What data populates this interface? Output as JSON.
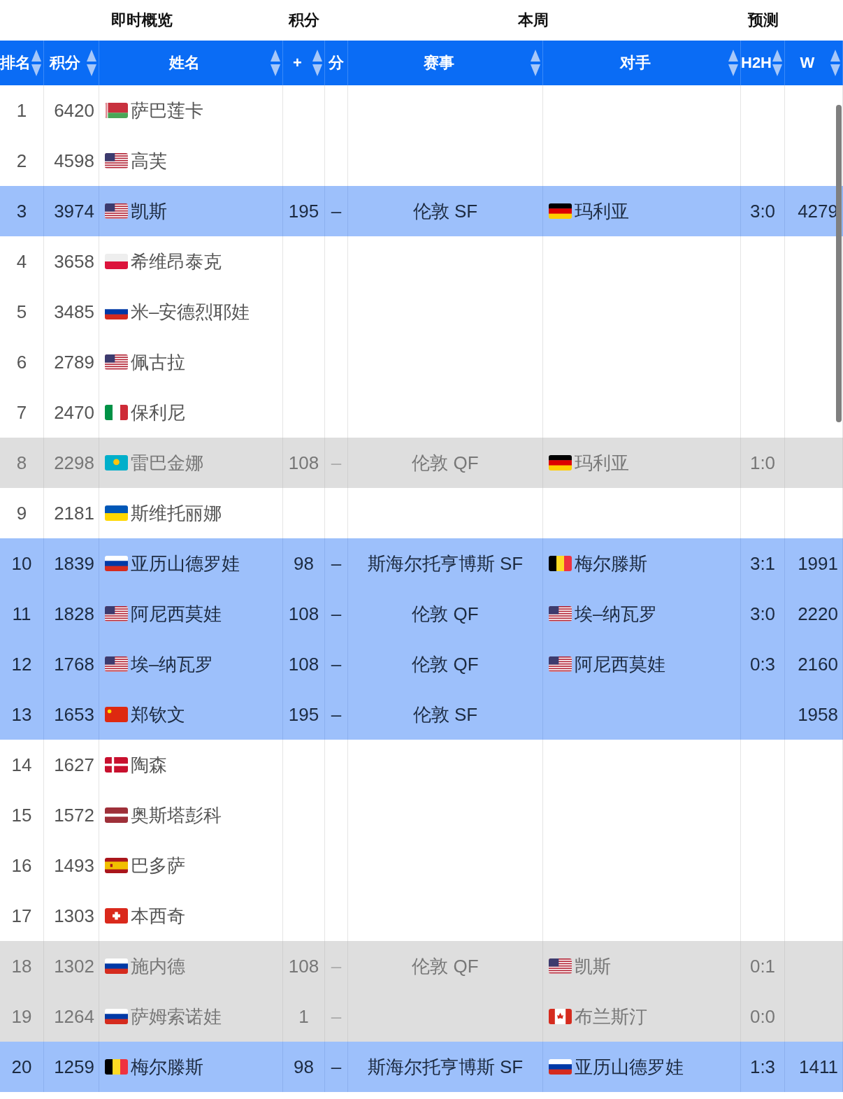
{
  "groups": [
    {
      "label": "即时概览"
    },
    {
      "label": "积分"
    },
    {
      "label": "本周"
    },
    {
      "label": "预测"
    }
  ],
  "columns": [
    {
      "label": "排名",
      "sortable": true
    },
    {
      "label": "积分",
      "sortable": true
    },
    {
      "label": "姓名",
      "sortable": true
    },
    {
      "label": "+",
      "sortable": true
    },
    {
      "label": "分",
      "sortable": false
    },
    {
      "label": "赛事",
      "sortable": true
    },
    {
      "label": "对手",
      "sortable": true
    },
    {
      "label": "H2H",
      "sortable": true
    },
    {
      "label": "W",
      "sortable": true
    }
  ],
  "rows": [
    {
      "rank": "1",
      "points": "6420",
      "flag": {
        "kind": "by"
      },
      "name": "萨巴莲卡",
      "playing": false,
      "out": false
    },
    {
      "rank": "2",
      "points": "4598",
      "flag": {
        "kind": "us"
      },
      "name": "高芙",
      "playing": false,
      "out": false
    },
    {
      "rank": "3",
      "points": "3974",
      "flag": {
        "kind": "us"
      },
      "name": "凯斯",
      "playing": true,
      "out": false,
      "plus": "195",
      "minus": "–",
      "event": "伦敦 SF",
      "opponent_flag": {
        "kind": "de"
      },
      "opponent": "玛利亚",
      "h2h": "3:0",
      "w": "4279"
    },
    {
      "rank": "4",
      "points": "3658",
      "flag": {
        "kind": "pl"
      },
      "name": "希维昂泰克",
      "playing": false,
      "out": false
    },
    {
      "rank": "5",
      "points": "3485",
      "flag": {
        "kind": "ru"
      },
      "name": "米–安德烈耶娃",
      "playing": false,
      "out": false
    },
    {
      "rank": "6",
      "points": "2789",
      "flag": {
        "kind": "us"
      },
      "name": "佩古拉",
      "playing": false,
      "out": false
    },
    {
      "rank": "7",
      "points": "2470",
      "flag": {
        "kind": "it"
      },
      "name": "保利尼",
      "playing": false,
      "out": false
    },
    {
      "rank": "8",
      "points": "2298",
      "flag": {
        "kind": "kz"
      },
      "name": "雷巴金娜",
      "playing": false,
      "out": true,
      "plus": "108",
      "minus": "–",
      "event": "伦敦 QF",
      "opponent_flag": {
        "kind": "de"
      },
      "opponent": "玛利亚",
      "h2h": "1:0"
    },
    {
      "rank": "9",
      "points": "2181",
      "flag": {
        "kind": "ua"
      },
      "name": "斯维托丽娜",
      "playing": false,
      "out": false
    },
    {
      "rank": "10",
      "points": "1839",
      "flag": {
        "kind": "ru"
      },
      "name": "亚历山德罗娃",
      "playing": true,
      "out": false,
      "plus": "98",
      "minus": "–",
      "event": "斯海尔托亨博斯 SF",
      "opponent_flag": {
        "kind": "be"
      },
      "opponent": "梅尔滕斯",
      "h2h": "3:1",
      "w": "1991"
    },
    {
      "rank": "11",
      "points": "1828",
      "flag": {
        "kind": "us"
      },
      "name": "阿尼西莫娃",
      "playing": true,
      "out": false,
      "plus": "108",
      "minus": "–",
      "event": "伦敦 QF",
      "opponent_flag": {
        "kind": "us"
      },
      "opponent": "埃–纳瓦罗",
      "h2h": "3:0",
      "w": "2220"
    },
    {
      "rank": "12",
      "points": "1768",
      "flag": {
        "kind": "us"
      },
      "name": "埃–纳瓦罗",
      "playing": true,
      "out": false,
      "plus": "108",
      "minus": "–",
      "event": "伦敦 QF",
      "opponent_flag": {
        "kind": "us"
      },
      "opponent": "阿尼西莫娃",
      "h2h": "0:3",
      "w": "2160"
    },
    {
      "rank": "13",
      "points": "1653",
      "flag": {
        "kind": "cn"
      },
      "name": "郑钦文",
      "playing": true,
      "out": false,
      "plus": "195",
      "minus": "–",
      "event": "伦敦 SF",
      "w": "1958"
    },
    {
      "rank": "14",
      "points": "1627",
      "flag": {
        "kind": "dk"
      },
      "name": "陶森",
      "playing": false,
      "out": false
    },
    {
      "rank": "15",
      "points": "1572",
      "flag": {
        "kind": "lv"
      },
      "name": "奥斯塔彭科",
      "playing": false,
      "out": false
    },
    {
      "rank": "16",
      "points": "1493",
      "flag": {
        "kind": "es"
      },
      "name": "巴多萨",
      "playing": false,
      "out": false
    },
    {
      "rank": "17",
      "points": "1303",
      "flag": {
        "kind": "ch"
      },
      "name": "本西奇",
      "playing": false,
      "out": false
    },
    {
      "rank": "18",
      "points": "1302",
      "flag": {
        "kind": "ru"
      },
      "name": "施内德",
      "playing": false,
      "out": true,
      "plus": "108",
      "minus": "–",
      "event": "伦敦 QF",
      "opponent_flag": {
        "kind": "us"
      },
      "opponent": "凯斯",
      "h2h": "0:1"
    },
    {
      "rank": "19",
      "points": "1264",
      "flag": {
        "kind": "ru"
      },
      "name": "萨姆索诺娃",
      "playing": false,
      "out": true,
      "plus": "1",
      "minus": "–",
      "opponent_flag": {
        "kind": "ca"
      },
      "opponent": "布兰斯汀",
      "h2h": "0:0"
    },
    {
      "rank": "20",
      "points": "1259",
      "flag": {
        "kind": "be"
      },
      "name": "梅尔滕斯",
      "playing": true,
      "out": false,
      "plus": "98",
      "minus": "–",
      "event": "斯海尔托亨博斯 SF",
      "opponent_flag": {
        "kind": "ru"
      },
      "opponent": "亚历山德罗娃",
      "h2h": "1:3",
      "w": "1411"
    }
  ]
}
